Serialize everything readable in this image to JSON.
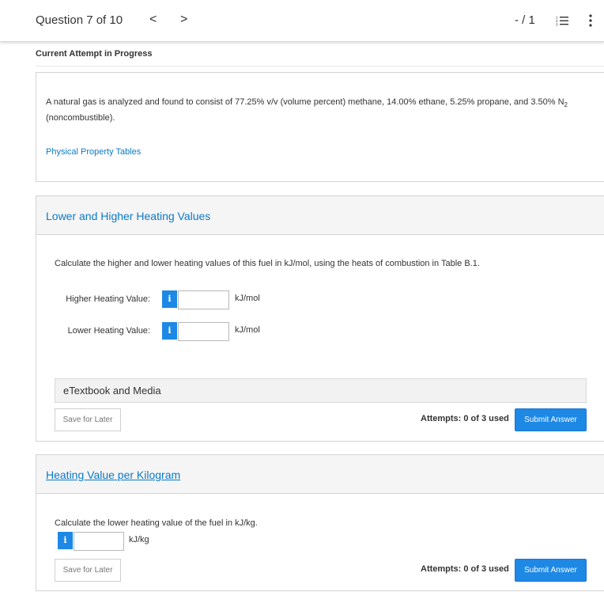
{
  "header": {
    "question_position": "Question 7 of 10",
    "prev_arrow": "<",
    "next_arrow": ">",
    "score": "- / 1",
    "list_icon": "question-list-icon",
    "menu_icon": "more-vertical-icon"
  },
  "attempt_status": "Current Attempt in Progress",
  "prompt": {
    "text_main": "A natural gas is analyzed and found to consist of 77.25% v/v (volume percent) methane, 14.00% ethane, 5.25% propane, and 3.50% N",
    "subscript": "2",
    "text_tail": "(noncombustible).",
    "tables_link": "Physical Property Tables"
  },
  "part1": {
    "title": "Lower and Higher Heating Values",
    "question": "Calculate the higher and lower heating values of this fuel in kJ/mol, using the heats of combustion in Table B.1.",
    "fields": [
      {
        "label": "Higher Heating Value:",
        "info": "i",
        "value": "",
        "unit": "kJ/mol"
      },
      {
        "label": "Lower Heating Value:",
        "info": "i",
        "value": "",
        "unit": "kJ/mol"
      }
    ],
    "etextbook": "eTextbook and Media",
    "save_label": "Save for Later",
    "attempts": "Attempts: 0 of 3 used",
    "submit_label": "Submit Answer"
  },
  "part2": {
    "title": "Heating Value per Kilogram",
    "question": "Calculate the lower heating value of the fuel in kJ/kg.",
    "field": {
      "info": "i",
      "value": "",
      "unit": "kJ/kg"
    },
    "save_label": "Save for Later",
    "attempts": "Attempts: 0 of 3 used",
    "submit_label": "Submit Answer"
  },
  "colors": {
    "link_blue": "#0a7ac8",
    "button_blue": "#1e88e5",
    "header_gray": "#f5f5f5"
  }
}
